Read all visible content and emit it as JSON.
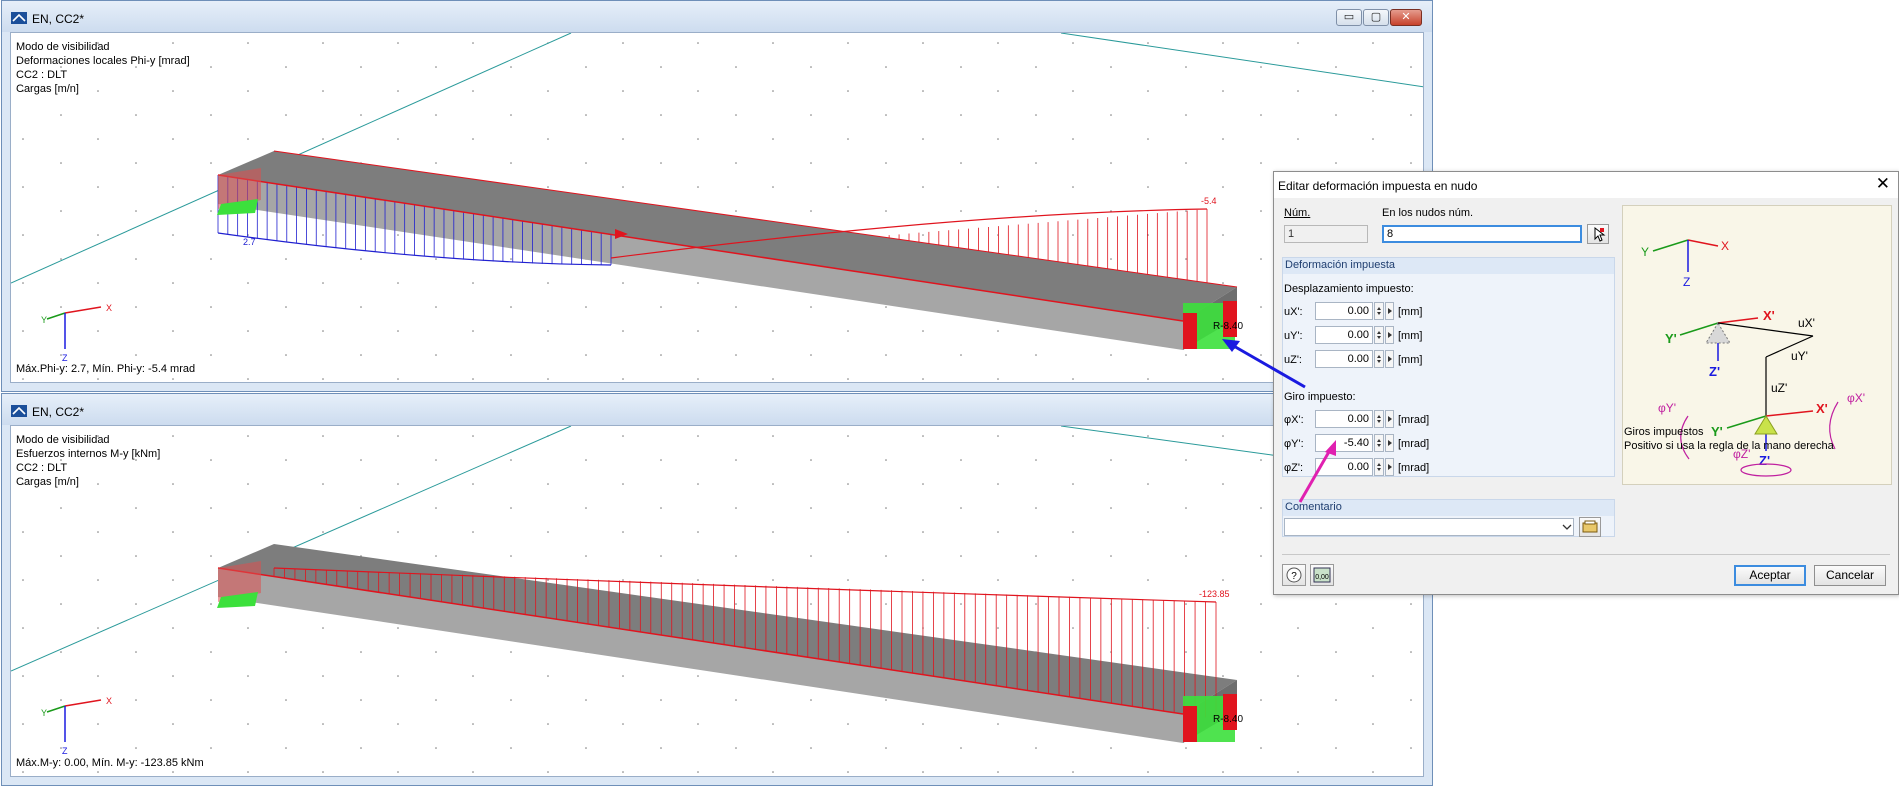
{
  "windows": [
    {
      "title": "EN, CC2*",
      "info": [
        "Modo de visibilidad",
        "Deformaciones locales Phi-y [mrad]",
        "CC2 : DLT",
        "Cargas [m/n]"
      ],
      "maxmin": "Máx.Phi-y: 2.7, Mín. Phi-y: -5.4 mrad",
      "value_left": "2.7",
      "value_right": "-5.4",
      "support_label": "R-8.40",
      "axes": {
        "x": "X",
        "y": "Y",
        "z": "Z"
      }
    },
    {
      "title": "EN, CC2*",
      "info": [
        "Modo de visibilidad",
        "Esfuerzos internos M-y [kNm]",
        "CC2 : DLT",
        "Cargas [m/n]"
      ],
      "maxmin": "Máx.M-y: 0.00, Mín. M-y: -123.85 kNm",
      "value_right": "-123.85",
      "support_label": "R-8.40",
      "axes": {
        "x": "X",
        "y": "Y",
        "z": "Z"
      }
    }
  ],
  "window_buttons": {
    "minimize": "▭",
    "maximize": "▢",
    "close": "✕"
  },
  "dialog": {
    "title": "Editar deformación impuesta en nudo",
    "close": "✕",
    "num_label": "Núm.",
    "num_value": "1",
    "nodes_label": "En los nudos núm.",
    "nodes_value": "8",
    "group_title": "Deformación impuesta",
    "disp_title": "Desplazamiento impuesto:",
    "disp": [
      {
        "label": "uX':",
        "value": "0.00",
        "unit": "[mm]"
      },
      {
        "label": "uY':",
        "value": "0.00",
        "unit": "[mm]"
      },
      {
        "label": "uZ':",
        "value": "0.00",
        "unit": "[mm]"
      }
    ],
    "rot_title": "Giro impuesto:",
    "rot": [
      {
        "label": "φX':",
        "value": "0.00",
        "unit": "[mrad]"
      },
      {
        "label": "φY':",
        "value": "-5.40",
        "unit": "[mrad]"
      },
      {
        "label": "φZ':",
        "value": "0.00",
        "unit": "[mrad]"
      }
    ],
    "comment_label": "Comentario",
    "comment_value": "",
    "image_caption_1": "Giros impuestos",
    "image_caption_2": "Positivo si usa la regla de la mano derecha",
    "image_labels": {
      "x": "X",
      "y": "Y",
      "z": "Z",
      "xp": "X'",
      "yp": "Y'",
      "zp": "Z'",
      "ux": "uX'",
      "uy": "uY'",
      "uz": "uZ'",
      "phix": "φX'",
      "phiy": "φY'",
      "phiz": "φZ'"
    },
    "ok": "Aceptar",
    "cancel": "Cancelar",
    "help_icon": "?",
    "units_icon": "0,00"
  },
  "colors": {
    "accent": "#3c8cdf",
    "beam_top": "#7d7d7d",
    "beam_front": "#a5a5a5",
    "diagram_red": "#e0141e",
    "diagram_blue": "#2020d0",
    "support": "#3ce03c",
    "arrow_blue": "#1a1ae0",
    "arrow_magenta": "#e020b0"
  }
}
